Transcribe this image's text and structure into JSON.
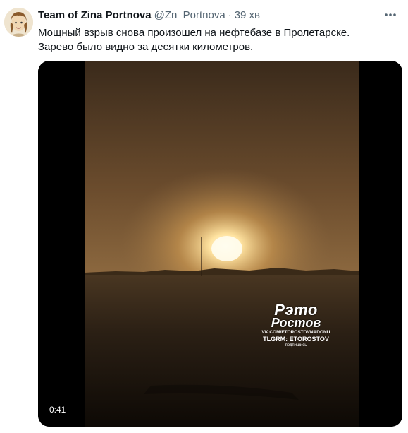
{
  "tweet": {
    "author_name": "Team of Zina Portnova",
    "handle": "@Zn_Portnova",
    "separator": "·",
    "time": "39 хв",
    "text_lines": [
      "Мощный взрыв снова произошел на нефтебазе в Пролетарске.",
      "Зарево было видно за десятки километров."
    ]
  },
  "media": {
    "type": "video",
    "duration": "0:41",
    "watermark": {
      "logo_line1": "Рэто",
      "logo_line2": "Ростов",
      "vk": "VK.COM/ETOROSTOVNADONU",
      "tg": "TLGRM: ETOROSTOV",
      "subscribe": "подпишись"
    }
  },
  "icons": {
    "more": "more-horizontal-icon",
    "avatar": "user-avatar"
  },
  "colors": {
    "text_primary": "#0f1419",
    "text_secondary": "#536471",
    "media_bg": "#000000"
  }
}
